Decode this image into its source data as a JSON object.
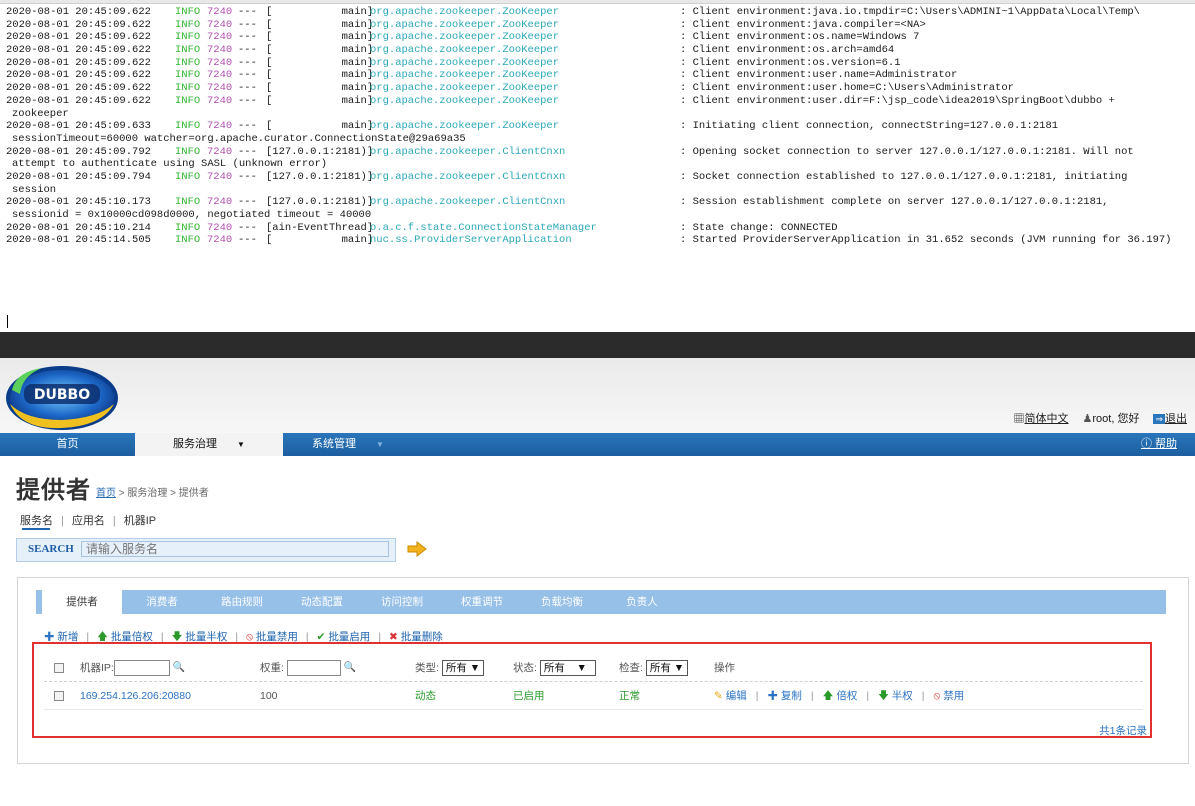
{
  "console": {
    "lines": [
      {
        "ts": "2020-08-01 20:45:09.622",
        "level": "INFO",
        "pid": "7240",
        "dash": "---",
        "thread": "[           main]",
        "logger": "org.apache.zookeeper.ZooKeeper",
        "msg": ": Client environment:java.io.tmpdir=C:\\Users\\ADMINI~1\\AppData\\Local\\Temp\\"
      },
      {
        "ts": "2020-08-01 20:45:09.622",
        "level": "INFO",
        "pid": "7240",
        "dash": "---",
        "thread": "[           main]",
        "logger": "org.apache.zookeeper.ZooKeeper",
        "msg": ": Client environment:java.compiler=<NA>"
      },
      {
        "ts": "2020-08-01 20:45:09.622",
        "level": "INFO",
        "pid": "7240",
        "dash": "---",
        "thread": "[           main]",
        "logger": "org.apache.zookeeper.ZooKeeper",
        "msg": ": Client environment:os.name=Windows 7"
      },
      {
        "ts": "2020-08-01 20:45:09.622",
        "level": "INFO",
        "pid": "7240",
        "dash": "---",
        "thread": "[           main]",
        "logger": "org.apache.zookeeper.ZooKeeper",
        "msg": ": Client environment:os.arch=amd64"
      },
      {
        "ts": "2020-08-01 20:45:09.622",
        "level": "INFO",
        "pid": "7240",
        "dash": "---",
        "thread": "[           main]",
        "logger": "org.apache.zookeeper.ZooKeeper",
        "msg": ": Client environment:os.version=6.1"
      },
      {
        "ts": "2020-08-01 20:45:09.622",
        "level": "INFO",
        "pid": "7240",
        "dash": "---",
        "thread": "[           main]",
        "logger": "org.apache.zookeeper.ZooKeeper",
        "msg": ": Client environment:user.name=Administrator"
      },
      {
        "ts": "2020-08-01 20:45:09.622",
        "level": "INFO",
        "pid": "7240",
        "dash": "---",
        "thread": "[           main]",
        "logger": "org.apache.zookeeper.ZooKeeper",
        "msg": ": Client environment:user.home=C:\\Users\\Administrator"
      },
      {
        "ts": "2020-08-01 20:45:09.622",
        "level": "INFO",
        "pid": "7240",
        "dash": "---",
        "thread": "[           main]",
        "logger": "org.apache.zookeeper.ZooKeeper",
        "msg": ": Client environment:user.dir=F:\\jsp_code\\idea2019\\SpringBoot\\dubbo +",
        "cont": "zookeeper"
      },
      {
        "ts": "2020-08-01 20:45:09.633",
        "level": "INFO",
        "pid": "7240",
        "dash": "---",
        "thread": "[           main]",
        "logger": "org.apache.zookeeper.ZooKeeper",
        "msg": ": Initiating client connection, connectString=127.0.0.1:2181",
        "cont": "sessionTimeout=60000 watcher=org.apache.curator.ConnectionState@29a69a35"
      },
      {
        "ts": "2020-08-01 20:45:09.792",
        "level": "INFO",
        "pid": "7240",
        "dash": "---",
        "thread": "[127.0.0.1:2181)]",
        "logger": "org.apache.zookeeper.ClientCnxn",
        "msg": ": Opening socket connection to server 127.0.0.1/127.0.0.1:2181. Will not",
        "cont": "attempt to authenticate using SASL (unknown error)"
      },
      {
        "ts": "2020-08-01 20:45:09.794",
        "level": "INFO",
        "pid": "7240",
        "dash": "---",
        "thread": "[127.0.0.1:2181)]",
        "logger": "org.apache.zookeeper.ClientCnxn",
        "msg": ": Socket connection established to 127.0.0.1/127.0.0.1:2181, initiating",
        "cont": "session"
      },
      {
        "ts": "2020-08-01 20:45:10.173",
        "level": "INFO",
        "pid": "7240",
        "dash": "---",
        "thread": "[127.0.0.1:2181)]",
        "logger": "org.apache.zookeeper.ClientCnxn",
        "msg": ": Session establishment complete on server 127.0.0.1/127.0.0.1:2181,",
        "cont": "sessionid = 0x10000cd098d0000, negotiated timeout = 40000"
      },
      {
        "ts": "2020-08-01 20:45:10.214",
        "level": "INFO",
        "pid": "7240",
        "dash": "---",
        "thread": "[ain-EventThread]",
        "logger": "o.a.c.f.state.ConnectionStateManager",
        "msg": ": State change: CONNECTED"
      },
      {
        "ts": "2020-08-01 20:45:14.505",
        "level": "INFO",
        "pid": "7240",
        "dash": "---",
        "thread": "[           main]",
        "logger": "nuc.ss.ProviderServerApplication",
        "msg": ": Started ProviderServerApplication in 31.652 seconds (JVM running for 36.197)"
      }
    ]
  },
  "header": {
    "logo_text": "DUBBO",
    "lang_link": "简体中文",
    "user_text": "root, 您好",
    "logout_link": "退出"
  },
  "nav": {
    "home": "首页",
    "governance": "服务治理",
    "system": "系统管理",
    "help": "帮助"
  },
  "page": {
    "title": "提供者",
    "breadcrumb_home": "首页",
    "breadcrumb_rest": " > 服务治理 > 提供者",
    "subtabs": [
      "服务名",
      "应用名",
      "机器IP"
    ]
  },
  "search": {
    "label": "SEARCH",
    "placeholder": "请输入服务名"
  },
  "tabs": [
    "提供者",
    "消费者",
    "路由规则",
    "动态配置",
    "访问控制",
    "权重调节",
    "负载均衡",
    "负责人"
  ],
  "actions": {
    "add": "新增",
    "double_weight": "批量倍权",
    "half_weight": "批量半权",
    "disable": "批量禁用",
    "enable": "批量启用",
    "delete": "批量删除"
  },
  "table": {
    "head": {
      "ip": "机器IP:",
      "weight": "权重:",
      "type": "类型:",
      "type_sel": "所有",
      "status": "状态:",
      "status_sel": "所有",
      "check": "检查:",
      "check_sel": "所有",
      "ops": "操作"
    },
    "row": {
      "ip": "169.254.126.206:20880",
      "weight": "100",
      "type": "动态",
      "status": "已启用",
      "check": "正常",
      "op_edit": "编辑",
      "op_copy": "复制",
      "op_double": "倍权",
      "op_half": "半权",
      "op_disable": "禁用"
    },
    "total": "共1条记录"
  }
}
